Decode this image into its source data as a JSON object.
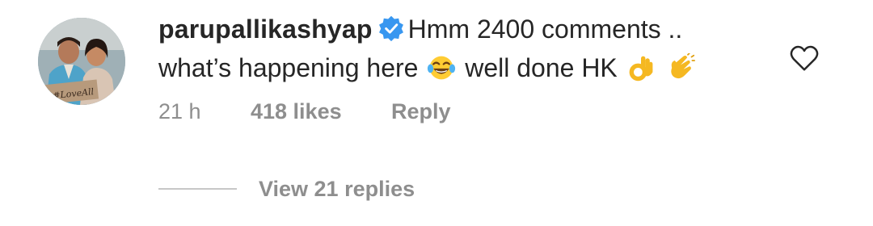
{
  "comment": {
    "avatar_icon": "profile-photo",
    "username": "parupallikashyap",
    "verified_icon": "verified-badge-icon",
    "text_line1": "Hmm 2400 comments ..",
    "text_line2_a": "what’s happening here",
    "emoji_1": "face-with-tears-of-joy-icon",
    "text_line2_b": "well done HK",
    "emoji_2": "ok-hand-icon",
    "emoji_3": "clapping-hands-icon"
  },
  "meta": {
    "time": "21 h",
    "likes": "418 likes",
    "reply_label": "Reply"
  },
  "like_icon": "heart-outline-icon",
  "replies": {
    "label": "View 21 replies"
  },
  "colors": {
    "text": "#262626",
    "secondary": "#8e8e8e",
    "verified": "#3897f0",
    "divider": "#c7c7c7"
  }
}
